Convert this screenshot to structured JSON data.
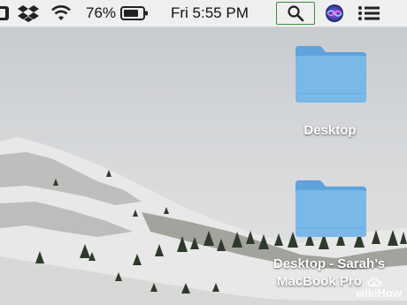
{
  "menubar": {
    "battery_percent": "76%",
    "clock": "Fri 5:55 PM",
    "icons": [
      "partial-app-icon",
      "dropbox-icon",
      "wifi-icon",
      "battery-icon",
      "spotlight-search-icon",
      "siri-icon",
      "notification-center-icon"
    ]
  },
  "desktop": {
    "items": [
      {
        "label": "Desktop",
        "icon": "folder-icon"
      },
      {
        "label_line1": "Desktop - Sarah’s",
        "label_line2": "MacBook Pro",
        "icon": "folder-icon",
        "badge": "icloud-icon"
      }
    ]
  },
  "watermark": "wikiHow",
  "colors": {
    "folder": "#7ab8e8",
    "folder_dark": "#5fa2dc",
    "menubar": "#efefef",
    "spotlight_border": "#3f8f3f"
  }
}
